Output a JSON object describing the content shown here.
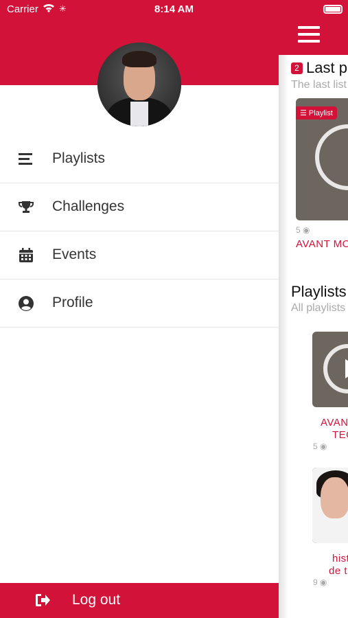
{
  "status_bar": {
    "carrier": "Carrier",
    "time": "8:14 AM"
  },
  "drawer": {
    "menu": [
      {
        "label": "Playlists",
        "icon": "list-icon"
      },
      {
        "label": "Challenges",
        "icon": "trophy-icon"
      },
      {
        "label": "Events",
        "icon": "calendar-icon"
      },
      {
        "label": "Profile",
        "icon": "user-circle-icon"
      }
    ],
    "logout_label": "Log out"
  },
  "content": {
    "last_section": {
      "badge_count": "2",
      "title": "Last p",
      "subtitle": "The last list"
    },
    "first_card": {
      "badge": "Playlist",
      "views": "5",
      "title": "AVANT MO"
    },
    "playlists_section": {
      "title": "Playlists",
      "subtitle": "All playlists"
    },
    "card2": {
      "title_line1": "AVANT",
      "title_line2": "TEC",
      "views": "5"
    },
    "card3": {
      "title_line1": "hist",
      "title_line2": "de t",
      "views": "9"
    }
  },
  "colors": {
    "brand": "#d21239"
  }
}
